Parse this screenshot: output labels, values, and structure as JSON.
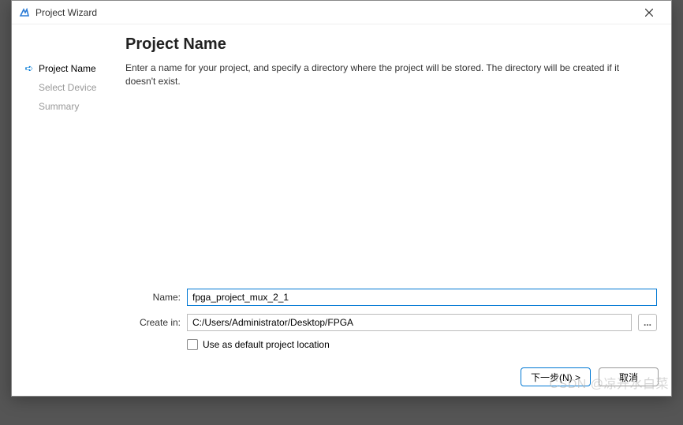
{
  "window": {
    "title": "Project Wizard"
  },
  "sidebar": {
    "steps": [
      {
        "label": "Project Name",
        "active": true
      },
      {
        "label": "Select Device",
        "active": false
      },
      {
        "label": "Summary",
        "active": false
      }
    ]
  },
  "main": {
    "heading": "Project Name",
    "description": "Enter a name for your project, and specify a directory where the project will be stored. The directory will be created if it doesn't exist."
  },
  "form": {
    "name_label": "Name:",
    "name_value": "fpga_project_mux_2_1",
    "path_label": "Create in:",
    "path_value": "C:/Users/Administrator/Desktop/FPGA",
    "browse_label": "...",
    "default_checkbox_label": "Use as default project location",
    "default_checked": false
  },
  "buttons": {
    "next": "下一步(N) >",
    "cancel": "取消"
  },
  "watermark": "CSDN @凉开水白菜"
}
